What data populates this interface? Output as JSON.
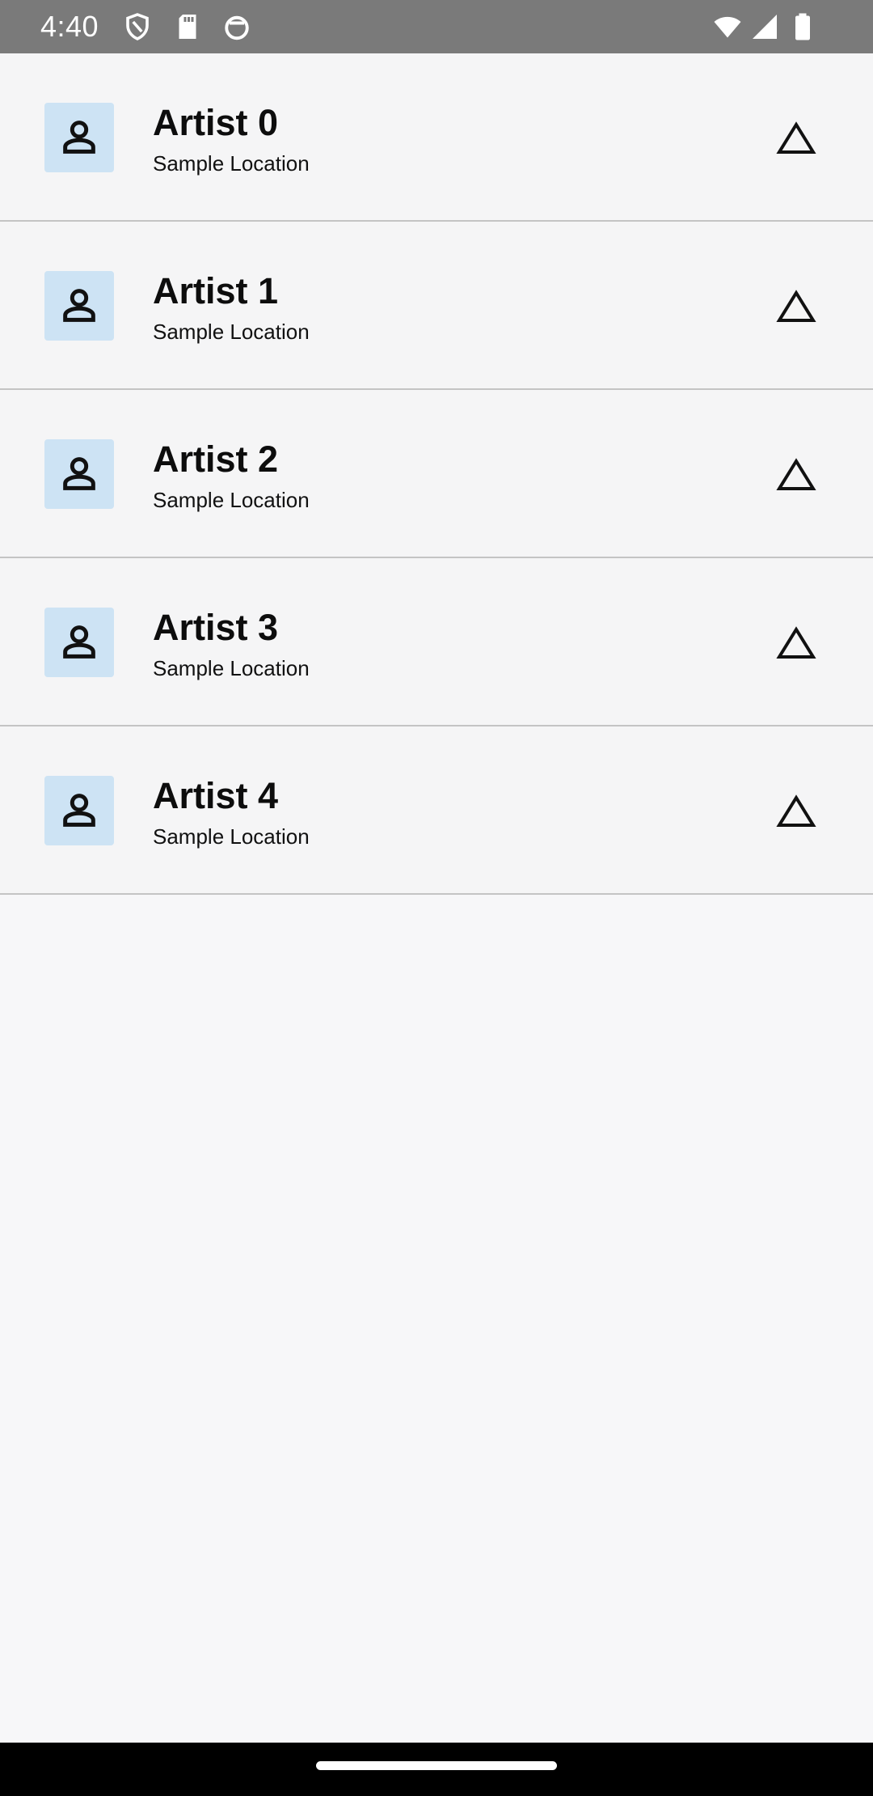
{
  "status_bar": {
    "time": "4:40",
    "left_icons": [
      "shield-icon",
      "sd-card-icon",
      "sync-icon"
    ],
    "right_icons": [
      "wifi-icon",
      "cellular-signal-icon",
      "battery-icon"
    ]
  },
  "list": {
    "items": [
      {
        "title": "Artist 0",
        "subtitle": "Sample Location",
        "icon": "person-icon",
        "toggle_icon": "triangle-up-icon"
      },
      {
        "title": "Artist 1",
        "subtitle": "Sample Location",
        "icon": "person-icon",
        "toggle_icon": "triangle-up-icon"
      },
      {
        "title": "Artist 2",
        "subtitle": "Sample Location",
        "icon": "person-icon",
        "toggle_icon": "triangle-up-icon"
      },
      {
        "title": "Artist 3",
        "subtitle": "Sample Location",
        "icon": "person-icon",
        "toggle_icon": "triangle-up-icon"
      },
      {
        "title": "Artist 4",
        "subtitle": "Sample Location",
        "icon": "person-icon",
        "toggle_icon": "triangle-up-icon"
      }
    ]
  },
  "colors": {
    "status_bar": "#7a7a7a",
    "avatar_background": "#cde3f4",
    "divider": "#c4c4c4",
    "background": "#f7f7f9",
    "nav_bar": "#000000"
  }
}
